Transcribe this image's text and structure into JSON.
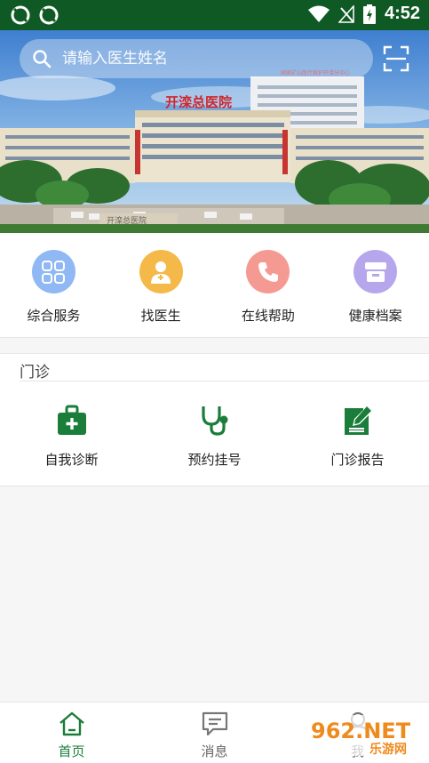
{
  "status_bar": {
    "time": "4:52"
  },
  "banner": {
    "hospital_sign": "开滦总医院",
    "building_sign": "国家矿山医疗救护开滦分中心",
    "ground_sign": "开滦总医院"
  },
  "search": {
    "placeholder": "请输入医生姓名"
  },
  "quick_menu": [
    {
      "label": "综合服务",
      "icon": "grid-icon",
      "color": "#8fb8f4"
    },
    {
      "label": "找医生",
      "icon": "doctor-icon",
      "color": "#f5b94a"
    },
    {
      "label": "在线帮助",
      "icon": "phone-icon",
      "color": "#f59a92"
    },
    {
      "label": "健康档案",
      "icon": "archive-icon",
      "color": "#b6a7ec"
    }
  ],
  "outpatient": {
    "title": "门诊",
    "items": [
      {
        "label": "自我诊断",
        "icon": "medical-kit-icon"
      },
      {
        "label": "预约挂号",
        "icon": "stethoscope-icon"
      },
      {
        "label": "门诊报告",
        "icon": "report-icon"
      }
    ]
  },
  "tabs": [
    {
      "label": "首页",
      "icon": "home-icon",
      "active": true
    },
    {
      "label": "消息",
      "icon": "message-icon",
      "active": false
    },
    {
      "label": "我",
      "icon": "profile-icon",
      "active": false
    }
  ],
  "watermark": {
    "text_top": "962.NET",
    "text_bottom": "乐游网"
  },
  "colors": {
    "status_bar": "#0f5a24",
    "brand_green": "#1a7d3a",
    "background": "#f6f6f6"
  }
}
